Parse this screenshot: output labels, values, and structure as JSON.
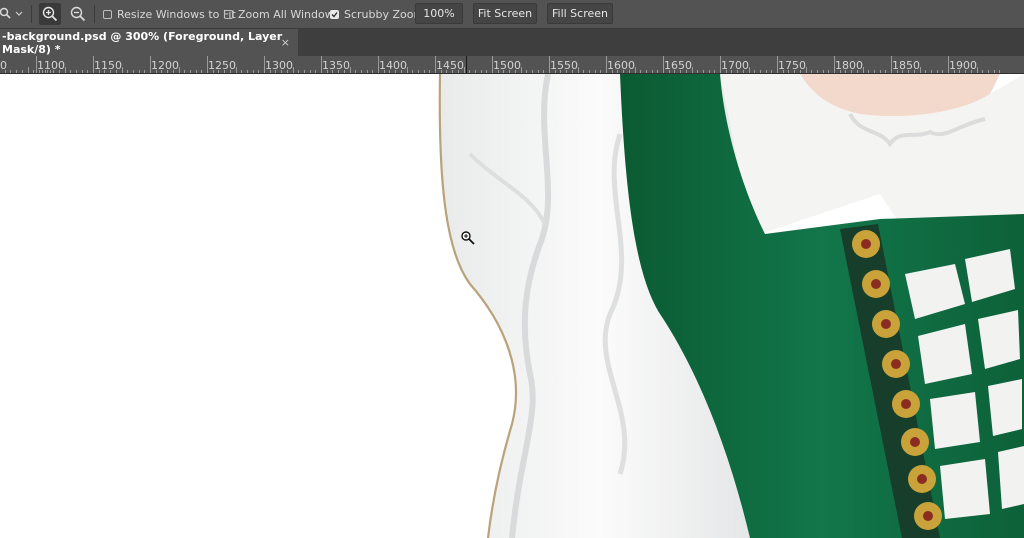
{
  "options_bar": {
    "zoom_in_icon": "zoom-in-icon",
    "zoom_out_icon": "zoom-out-icon",
    "resize_windows_label": "Resize Windows to Fit",
    "resize_windows_checked": false,
    "zoom_all_label": "Zoom All Windows",
    "zoom_all_checked": false,
    "scrubby_zoom_label": "Scrubby Zoom",
    "scrubby_zoom_checked": true,
    "zoom_value": "100%",
    "fit_screen_label": "Fit Screen",
    "fill_screen_label": "Fill Screen"
  },
  "document_tab": {
    "title": "-background.psd @ 300% (Foreground, Layer Mask/8) *",
    "close": "×"
  },
  "ruler": {
    "labels": [
      "0",
      "1100",
      "1150",
      "1200",
      "1250",
      "1300",
      "1350",
      "1400",
      "1450",
      "1500",
      "1550",
      "1600",
      "1650",
      "1700",
      "1750",
      "1800",
      "1850",
      "1900"
    ]
  },
  "canvas": {
    "description_colors": {
      "dress_green": "#0f6b3c",
      "blouse_white": "#f2f2f0",
      "trim_gold": "#c9a23a",
      "skin": "#f3d9cc"
    }
  }
}
